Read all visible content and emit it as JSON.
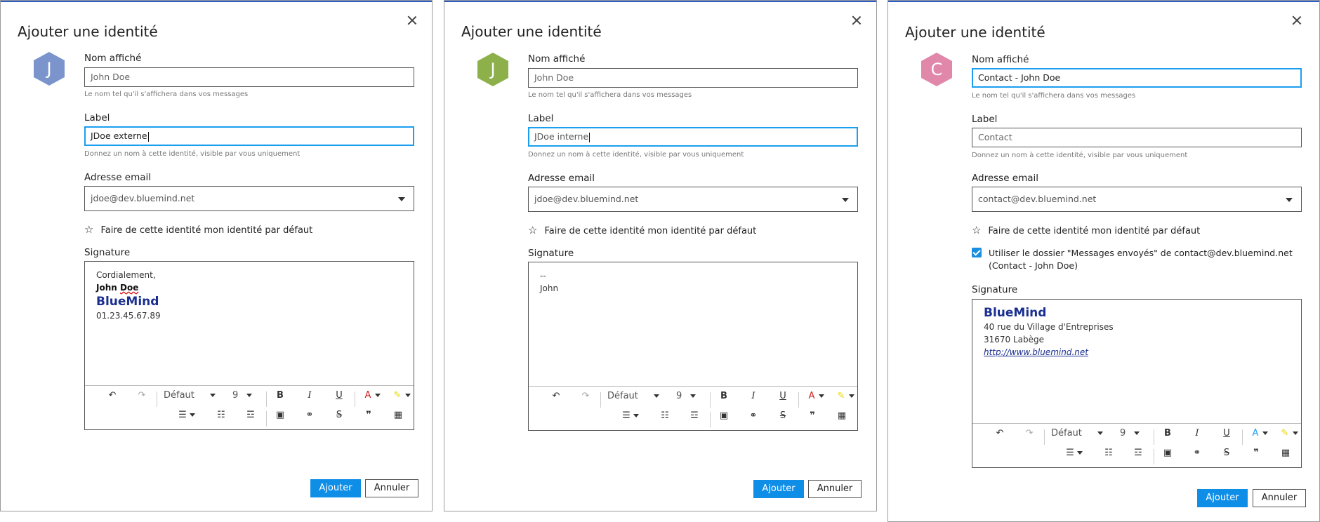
{
  "common": {
    "title": "Ajouter une identité",
    "display_name_label": "Nom affiché",
    "display_name_hint": "Le nom tel qu'il s'affichera dans vos messages",
    "label_label": "Label",
    "label_hint": "Donnez un nom à cette identité, visible par vous uniquement",
    "email_label": "Adresse email",
    "default_text": "Faire de cette identité mon identité par défaut",
    "signature_label": "Signature",
    "add_button": "Ajouter",
    "cancel_button": "Annuler",
    "toolbar": {
      "font": "Défaut",
      "size": "9",
      "bold": "B",
      "italic": "I",
      "underline": "U",
      "color": "A",
      "quote": "❞"
    }
  },
  "dialogs": [
    {
      "avatar_letter": "J",
      "avatar_color": "#7b95cc",
      "display_name": "John Doe",
      "label_value": "JDoe externe",
      "email": "jdoe@dev.bluemind.net",
      "signature": {
        "line1": "Cordialement,",
        "name_first": "John ",
        "name_last": "Doe",
        "brand": "BlueMind",
        "phone": "01.23.45.67.89"
      }
    },
    {
      "avatar_letter": "J",
      "avatar_color": "#8db04a",
      "display_name": "John Doe",
      "label_value": "JDoe interne",
      "email": "jdoe@dev.bluemind.net",
      "signature": {
        "line1": "--",
        "line2": "John"
      }
    },
    {
      "avatar_letter": "C",
      "avatar_color": "#e087aa",
      "display_name": "Contact - John Doe",
      "label_placeholder": "Contact",
      "email": "contact@dev.bluemind.net",
      "sent_folder_text": "Utiliser le dossier \"Messages envoyés\" de contact@dev.bluemind.net (Contact - John Doe)",
      "sent_folder_checked": true,
      "signature": {
        "brand": "BlueMind",
        "address1": "40 rue du Village d'Entreprises",
        "address2": "31670 Labège",
        "url": "http://www.bluemind.net"
      }
    }
  ]
}
